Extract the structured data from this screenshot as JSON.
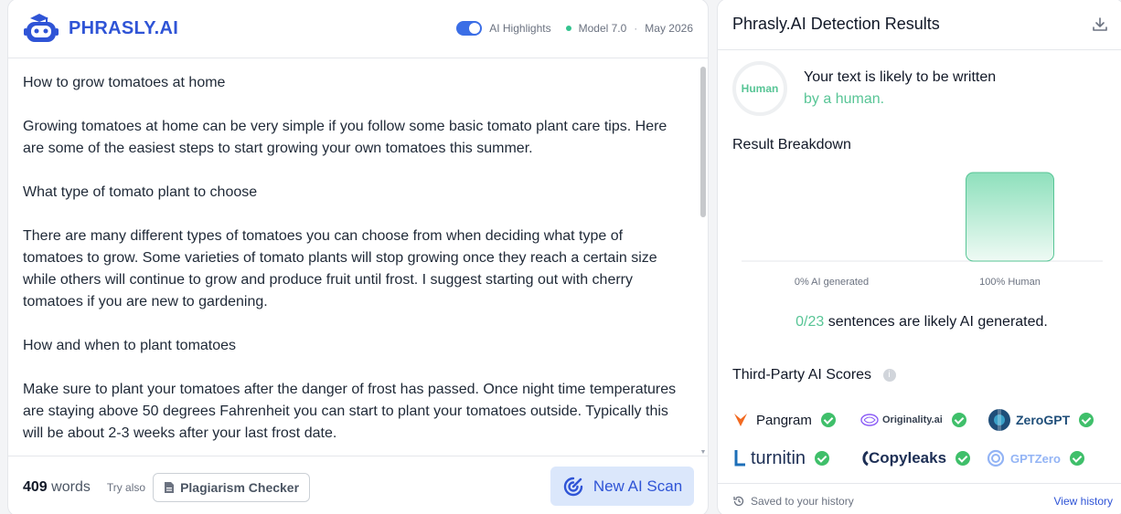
{
  "header": {
    "logo_text": "PHRASLY.AI",
    "ai_highlights_label": "AI Highlights",
    "model_label": "Model 7.0",
    "date_label": "May 2026"
  },
  "editor": {
    "paragraphs": [
      "How to grow tomatoes at home",
      "Growing tomatoes at home can be very simple if you follow some basic tomato plant care tips. Here are some of the easiest steps to start growing your own tomatoes this summer.",
      "What type of tomato plant to choose",
      "There are many different types of tomatoes you can choose from when deciding what type of tomatoes to grow. Some varieties of tomato plants will stop growing once they reach a certain size while others will continue to grow and produce fruit until frost. I suggest starting out with cherry tomatoes if you are new to gardening.",
      "How and when to plant tomatoes",
      "Make sure to plant your tomatoes after the danger of frost has passed. Once night time temperatures are staying above 50 degrees Fahrenheit you can start to plant your tomatoes outside. Typically this will be about 2-3 weeks after your last frost date."
    ]
  },
  "footer": {
    "word_count": "409",
    "word_label": "words",
    "try_also": "Try also",
    "plagiarism_button": "Plagiarism Checker",
    "scan_button": "New AI Scan"
  },
  "results": {
    "title": "Phrasly.AI Detection Results",
    "ring_label": "Human",
    "likely_text": "Your text is likely to be written",
    "likely_who": "by a human.",
    "breakdown_title": "Result Breakdown",
    "sentences_count": "0/23",
    "sentences_mid": " sentences are likely ",
    "sentences_ai": "AI generated",
    "sentences_end": ".",
    "third_party_title": "Third-Party AI Scores",
    "detectors": [
      "Pangram",
      "Originality.ai",
      "ZeroGPT",
      "turnitin",
      "Copyleaks",
      "GPTZero"
    ],
    "saved_text": "Saved to your history",
    "view_history": "View history"
  },
  "chart_data": {
    "type": "bar",
    "categories": [
      "0% AI generated",
      "100% Human"
    ],
    "values": [
      0,
      100
    ],
    "ylim": [
      0,
      100
    ],
    "colors": [
      "#58c596",
      "#58c596"
    ]
  },
  "colors": {
    "brand": "#2f54d6",
    "human_green": "#58c596",
    "check_green": "#3fbf6a"
  }
}
